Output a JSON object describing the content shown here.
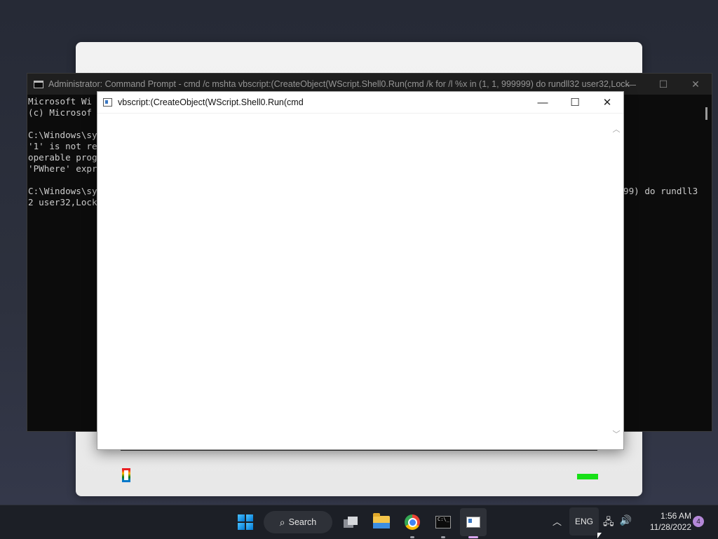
{
  "cmd_window": {
    "title": "Administrator: Command Prompt - cmd  /c mshta vbscript:(CreateObject(WScript.Shell0.Run(cmd /k for /l %x in (1, 1, 999999) do rundll32 user32,Lock...",
    "lines": [
      "Microsoft Wi",
      "(c) Microsof",
      "",
      "C:\\Windows\\sy",
      "'1' is not re",
      "operable prog",
      "'PWhere' expr",
      "",
      "C:\\Windows\\sy",
      "2 user32,Lock"
    ],
    "right_fragment": "99) do rundll3"
  },
  "hta_window": {
    "title": "vbscript:(CreateObject(WScript.Shell0.Run(cmd"
  },
  "controls": {
    "minimize": "—",
    "maximize": "☐",
    "close": "✕"
  },
  "taskbar": {
    "search_label": "Search",
    "language": "ENG",
    "time": "1:56 AM",
    "date": "11/28/2022",
    "notification_count": "4",
    "terminal_prompt": "C:\\_"
  },
  "icons": {
    "start": "windows-start-icon",
    "search": "search-icon",
    "task_view": "task-view-icon",
    "explorer": "folder-icon",
    "chrome": "chrome-icon",
    "terminal": "command-prompt-icon",
    "hta": "application-window-icon"
  },
  "colors": {
    "cmd_background": "#0c0c0c",
    "taskbar": "#1c1f26",
    "accent": "#0078d4",
    "badge": "#b488d8"
  }
}
